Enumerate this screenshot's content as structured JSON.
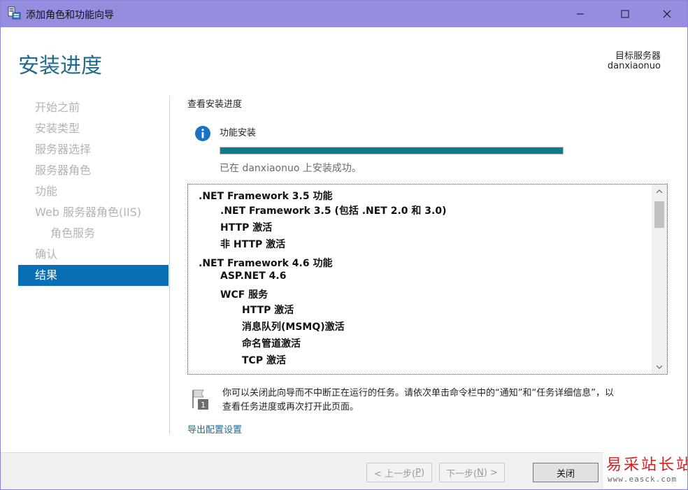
{
  "window": {
    "title": "添加角色和功能向导",
    "icon": "server-wizard-icon"
  },
  "header": {
    "title": "安装进度",
    "target_label": "目标服务器",
    "target_name": "danxiaonuo"
  },
  "nav": {
    "items": [
      {
        "label": "开始之前"
      },
      {
        "label": "安装类型"
      },
      {
        "label": "服务器选择"
      },
      {
        "label": "服务器角色"
      },
      {
        "label": "功能"
      },
      {
        "label": "Web 服务器角色(IIS)"
      },
      {
        "label": "角色服务"
      },
      {
        "label": "确认"
      },
      {
        "label": "结果"
      }
    ],
    "active": "结果"
  },
  "main": {
    "section_title": "查看安装进度",
    "feature_label": "功能安装",
    "progress_fraction": 1.0,
    "status": "已在 danxiaonuo 上安装成功。",
    "list": [
      ".NET Framework 3.5 功能",
      ".NET Framework 3.5 (包括 .NET 2.0 和 3.0)",
      "HTTP 激活",
      "非 HTTP 激活",
      ".NET Framework 4.6 功能",
      "ASP.NET 4.6",
      "WCF 服务",
      "HTTP 激活",
      "消息队列(MSMQ)激活",
      "命名管道激活",
      "TCP 激活"
    ],
    "notice_line1": "你可以关闭此向导而不中断正在运行的任务。请依次单击命令栏中的“通知”和“任务详细信息”，以",
    "notice_line2": "查看任务进度或再次打开此页面。",
    "export_link": "导出配置设置"
  },
  "footer": {
    "prev_text": "< 上一步(",
    "prev_key": "P",
    "prev_end": ")",
    "next_text": "下一步(",
    "next_key": "N",
    "next_end": ") >",
    "close_label": "关闭"
  },
  "watermark": {
    "title": "易采站长站",
    "url": "www.easck.com"
  },
  "colors": {
    "titlebar": "#948de0",
    "accent": "#1f6a8e",
    "nav_active": "#0a6eb4",
    "progress": "#0e7b8d",
    "watermark": "#d42020"
  }
}
